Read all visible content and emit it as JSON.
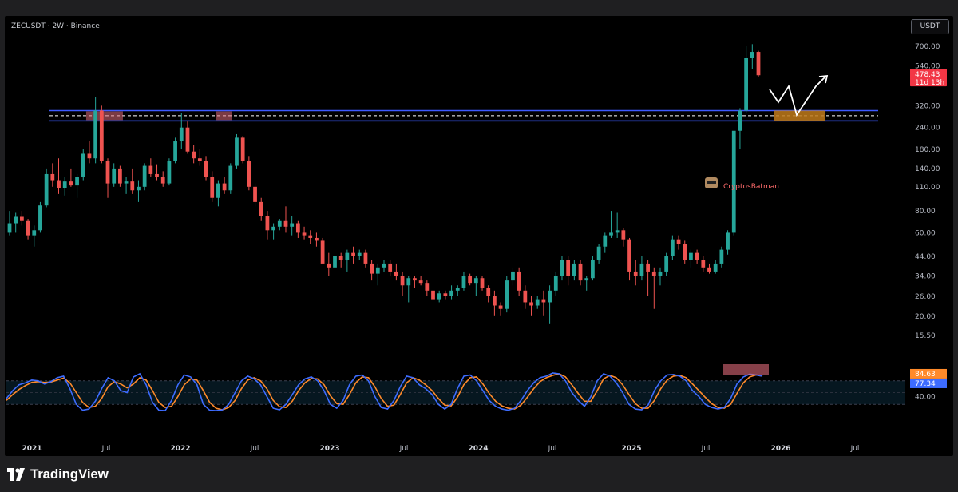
{
  "header": {
    "symbol_label": "ZECUSDT · 2W · Binance",
    "currency": "USDT"
  },
  "footer": {
    "brand": "TradingView"
  },
  "watermark": {
    "text": "CryptosBatman"
  },
  "colors": {
    "up": "#26a69a",
    "down": "#ef5350",
    "zone_line": "#3d5afe",
    "zone_fill": "#e06b7a",
    "target_zone": "#c07a1a",
    "stoch_k": "#3d6cff",
    "stoch_d": "#ff8a2a",
    "stoch_band": "#0b2a3a"
  },
  "chart_data": [
    {
      "type": "candlestick",
      "title": "ZECUSDT · 2W · Binance",
      "y_scale": "log",
      "y_ticks": [
        "700.00",
        "540.00",
        "320.00",
        "240.00",
        "180.00",
        "140.00",
        "110.00",
        "80.00",
        "60.00",
        "44.00",
        "34.00",
        "26.00",
        "20.00",
        "15.50"
      ],
      "x_ticks": [
        "2021",
        "Jul",
        "2022",
        "Jul",
        "2023",
        "Jul",
        "2024",
        "Jul",
        "2025",
        "Jul",
        "2026",
        "Jul"
      ],
      "last_price": "478.43",
      "countdown": "11d 13h",
      "resistance_zone": [
        262,
        300
      ],
      "candles": [
        [
          60,
          80,
          58,
          68
        ],
        [
          68,
          78,
          60,
          74
        ],
        [
          74,
          80,
          66,
          70
        ],
        [
          70,
          72,
          55,
          58
        ],
        [
          58,
          66,
          50,
          62
        ],
        [
          62,
          90,
          60,
          86
        ],
        [
          86,
          140,
          84,
          130
        ],
        [
          130,
          150,
          110,
          120
        ],
        [
          120,
          160,
          100,
          108
        ],
        [
          108,
          125,
          98,
          118
        ],
        [
          118,
          140,
          110,
          112
        ],
        [
          112,
          130,
          95,
          125
        ],
        [
          125,
          180,
          120,
          170
        ],
        [
          170,
          200,
          150,
          160
        ],
        [
          160,
          360,
          150,
          300
        ],
        [
          300,
          320,
          150,
          155
        ],
        [
          155,
          160,
          95,
          115
        ],
        [
          115,
          150,
          110,
          140
        ],
        [
          140,
          145,
          110,
          115
        ],
        [
          115,
          125,
          100,
          118
        ],
        [
          118,
          140,
          100,
          105
        ],
        [
          105,
          120,
          90,
          110
        ],
        [
          110,
          150,
          105,
          145
        ],
        [
          145,
          160,
          125,
          130
        ],
        [
          130,
          148,
          120,
          125
        ],
        [
          125,
          135,
          110,
          115
        ],
        [
          115,
          160,
          112,
          155
        ],
        [
          155,
          210,
          150,
          200
        ],
        [
          200,
          290,
          180,
          240
        ],
        [
          240,
          260,
          170,
          175
        ],
        [
          175,
          190,
          150,
          160
        ],
        [
          160,
          180,
          145,
          155
        ],
        [
          155,
          165,
          120,
          125
        ],
        [
          125,
          135,
          90,
          95
        ],
        [
          95,
          120,
          85,
          115
        ],
        [
          115,
          125,
          100,
          105
        ],
        [
          105,
          150,
          100,
          145
        ],
        [
          145,
          220,
          140,
          210
        ],
        [
          210,
          215,
          150,
          155
        ],
        [
          155,
          165,
          105,
          110
        ],
        [
          110,
          115,
          85,
          90
        ],
        [
          90,
          95,
          70,
          75
        ],
        [
          75,
          80,
          55,
          62
        ],
        [
          62,
          68,
          55,
          65
        ],
        [
          65,
          72,
          62,
          70
        ],
        [
          70,
          85,
          60,
          65
        ],
        [
          65,
          75,
          58,
          68
        ],
        [
          68,
          70,
          56,
          60
        ],
        [
          60,
          65,
          55,
          58
        ],
        [
          58,
          62,
          52,
          56
        ],
        [
          56,
          60,
          50,
          54
        ],
        [
          54,
          56,
          44,
          40
        ],
        [
          40,
          46,
          34,
          38
        ],
        [
          38,
          46,
          36,
          44
        ],
        [
          44,
          46,
          38,
          42
        ],
        [
          42,
          48,
          36,
          46
        ],
        [
          46,
          50,
          40,
          44
        ],
        [
          44,
          48,
          42,
          46
        ],
        [
          46,
          48,
          38,
          40
        ],
        [
          40,
          42,
          32,
          35
        ],
        [
          35,
          40,
          30,
          38
        ],
        [
          38,
          42,
          36,
          40
        ],
        [
          40,
          42,
          34,
          36
        ],
        [
          36,
          40,
          32,
          34
        ],
        [
          34,
          36,
          26,
          30
        ],
        [
          30,
          34,
          24,
          33
        ],
        [
          33,
          34,
          29,
          32
        ],
        [
          32,
          34,
          30,
          31
        ],
        [
          31,
          32,
          26,
          28
        ],
        [
          28,
          30,
          22,
          25
        ],
        [
          25,
          28,
          24,
          27
        ],
        [
          27,
          28,
          25,
          26
        ],
        [
          26,
          30,
          25,
          28
        ],
        [
          28,
          30,
          26,
          29
        ],
        [
          29,
          36,
          28,
          34
        ],
        [
          34,
          35,
          30,
          31
        ],
        [
          31,
          34,
          26,
          33
        ],
        [
          33,
          34,
          28,
          29
        ],
        [
          29,
          30,
          24,
          26
        ],
        [
          26,
          28,
          20,
          23
        ],
        [
          23,
          24,
          20,
          22
        ],
        [
          22,
          34,
          21,
          32
        ],
        [
          32,
          38,
          30,
          36
        ],
        [
          36,
          38,
          26,
          28
        ],
        [
          28,
          30,
          22,
          24
        ],
        [
          24,
          26,
          20,
          23
        ],
        [
          23,
          26,
          22,
          25
        ],
        [
          25,
          28,
          20,
          24
        ],
        [
          24,
          30,
          18,
          28
        ],
        [
          28,
          36,
          26,
          34
        ],
        [
          34,
          44,
          32,
          42
        ],
        [
          42,
          44,
          30,
          34
        ],
        [
          34,
          42,
          32,
          40
        ],
        [
          40,
          42,
          30,
          32
        ],
        [
          32,
          34,
          28,
          33
        ],
        [
          33,
          44,
          32,
          42
        ],
        [
          42,
          52,
          40,
          50
        ],
        [
          50,
          60,
          46,
          58
        ],
        [
          58,
          80,
          56,
          60
        ],
        [
          60,
          78,
          56,
          62
        ],
        [
          62,
          64,
          50,
          55
        ],
        [
          55,
          56,
          32,
          36
        ],
        [
          36,
          42,
          30,
          34
        ],
        [
          34,
          44,
          32,
          40
        ],
        [
          40,
          42,
          26,
          36
        ],
        [
          36,
          38,
          22,
          34
        ],
        [
          34,
          38,
          30,
          36
        ],
        [
          36,
          46,
          34,
          44
        ],
        [
          44,
          58,
          42,
          55
        ],
        [
          55,
          58,
          48,
          52
        ],
        [
          52,
          54,
          40,
          42
        ],
        [
          42,
          48,
          38,
          46
        ],
        [
          46,
          48,
          40,
          42
        ],
        [
          42,
          44,
          36,
          38
        ],
        [
          38,
          40,
          35,
          36
        ],
        [
          36,
          42,
          35,
          40
        ],
        [
          40,
          50,
          38,
          48
        ],
        [
          48,
          62,
          45,
          60
        ],
        [
          60,
          130,
          58,
          230
        ],
        [
          230,
          310,
          180,
          300
        ],
        [
          300,
          700,
          290,
          600
        ],
        [
          600,
          720,
          520,
          650
        ],
        [
          650,
          660,
          470,
          478
        ]
      ]
    },
    {
      "type": "line",
      "title": "Stochastic RSI",
      "y_ticks": [
        "40.00"
      ],
      "series": [
        {
          "name": "%K",
          "last": "84.63",
          "values": [
            35,
            55,
            70,
            75,
            82,
            80,
            72,
            78,
            88,
            92,
            60,
            20,
            5,
            8,
            28,
            60,
            88,
            80,
            55,
            50,
            90,
            98,
            70,
            25,
            5,
            4,
            30,
            70,
            95,
            90,
            70,
            20,
            5,
            4,
            6,
            20,
            50,
            80,
            92,
            85,
            70,
            40,
            10,
            6,
            20,
            45,
            70,
            85,
            90,
            80,
            55,
            20,
            10,
            30,
            70,
            92,
            95,
            80,
            40,
            12,
            8,
            30,
            65,
            92,
            88,
            70,
            60,
            45,
            20,
            8,
            20,
            60,
            92,
            95,
            80,
            55,
            30,
            15,
            8,
            5,
            10,
            30,
            55,
            75,
            88,
            92,
            100,
            98,
            80,
            50,
            30,
            15,
            40,
            80,
            98,
            92,
            75,
            50,
            20,
            8,
            6,
            18,
            55,
            80,
            95,
            96,
            92,
            80,
            55,
            40,
            20,
            12,
            8,
            12,
            35,
            72,
            90,
            97,
            95,
            92
          ]
        },
        {
          "name": "%D",
          "last": "77.34",
          "values": [
            30,
            45,
            58,
            68,
            76,
            78,
            76,
            77,
            82,
            87,
            75,
            50,
            25,
            12,
            15,
            35,
            65,
            78,
            72,
            62,
            72,
            88,
            82,
            55,
            25,
            12,
            15,
            40,
            70,
            85,
            82,
            55,
            25,
            10,
            6,
            12,
            30,
            60,
            82,
            88,
            80,
            60,
            30,
            14,
            12,
            28,
            55,
            75,
            86,
            85,
            70,
            42,
            22,
            20,
            45,
            75,
            90,
            88,
            65,
            35,
            15,
            18,
            45,
            75,
            88,
            82,
            70,
            55,
            35,
            18,
            16,
            38,
            70,
            88,
            90,
            72,
            48,
            28,
            16,
            10,
            8,
            18,
            38,
            60,
            78,
            88,
            94,
            98,
            90,
            70,
            48,
            28,
            28,
            55,
            85,
            94,
            88,
            70,
            45,
            22,
            10,
            10,
            30,
            60,
            82,
            92,
            94,
            88,
            72,
            55,
            38,
            22,
            12,
            10,
            20,
            48,
            75,
            90,
            95,
            92
          ]
        }
      ]
    }
  ]
}
